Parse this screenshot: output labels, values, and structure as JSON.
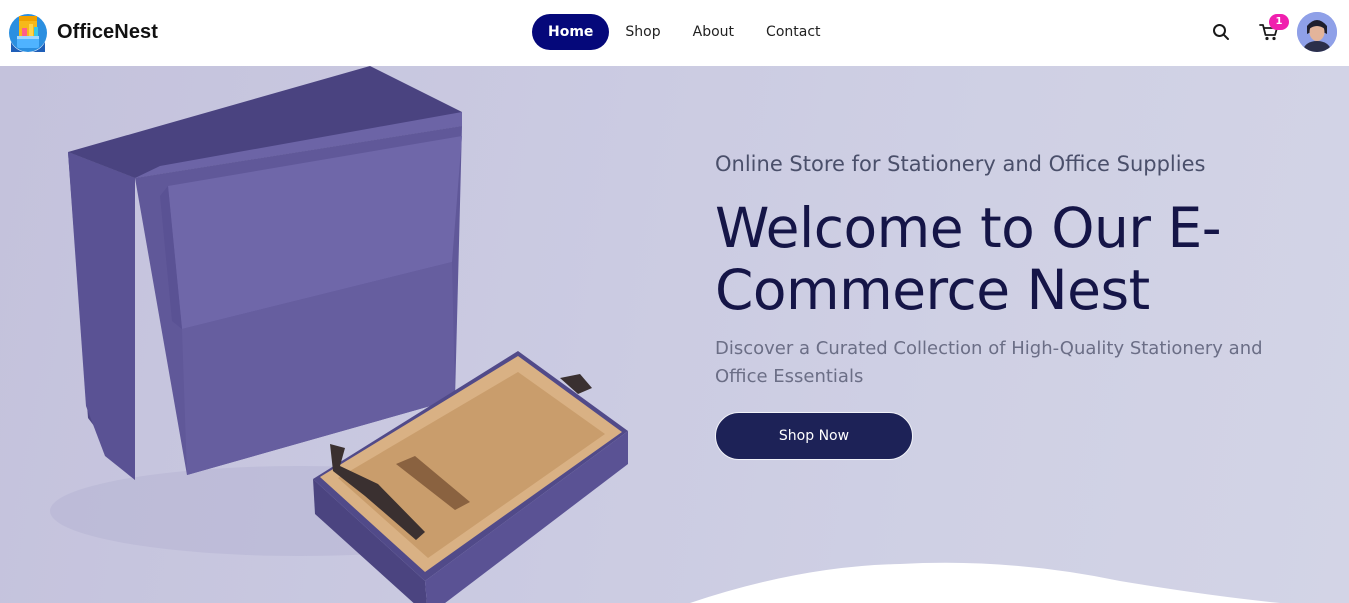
{
  "brand": {
    "name": "OfficeNest",
    "logo_icon": "stationery-cup-logo-icon"
  },
  "nav": {
    "links": [
      {
        "label": "Home",
        "active": true
      },
      {
        "label": "Shop",
        "active": false
      },
      {
        "label": "About",
        "active": false
      },
      {
        "label": "Contact",
        "active": false
      }
    ],
    "active_color": "#05087a"
  },
  "header_actions": {
    "search_icon": "search-icon",
    "cart_icon": "cart-icon",
    "cart_count": "1",
    "badge_color": "#f01fae",
    "avatar_icon": "user-avatar"
  },
  "hero": {
    "tagline": "Online Store for Stationery and Office Supplies",
    "title": "Welcome to Our E-Commerce Nest",
    "subtitle": "Discover a Curated Collection of High-Quality Stationery and Office Essentials",
    "cta_label": "Shop Now",
    "cta_color": "#1d2257",
    "title_color": "#151547",
    "image_icon": "purple-gift-box-illustration"
  }
}
